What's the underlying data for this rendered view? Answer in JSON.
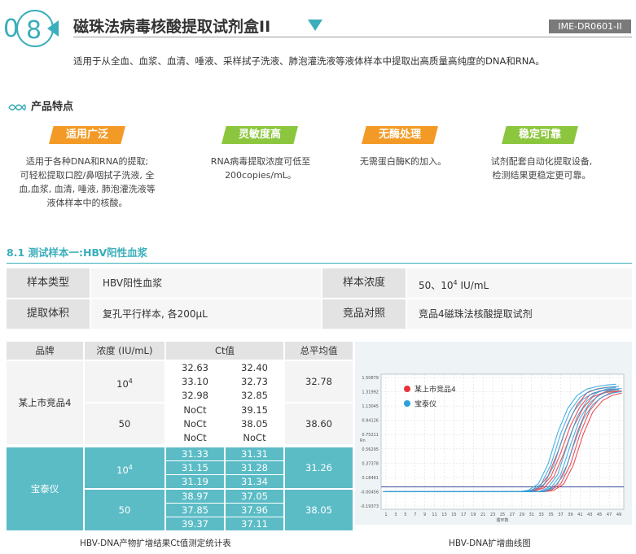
{
  "header": {
    "num_zero": "0",
    "num_eight": "8",
    "title": "磁珠法病毒核酸提取试剂盒II",
    "code": "IME-DR0601-II",
    "description": "适用于从全血、血浆、血清、唾液、采样拭子洗液、肺泡灌洗液等液体样本中提取出高质量高纯度的DNA和RNA。"
  },
  "features": {
    "title": "产品特点",
    "items": [
      {
        "label": "适用广泛",
        "lines": [
          "适用于各种DNA和RNA的提取;",
          "可轻松提取口腔/鼻咽拭子洗液, 全",
          "血,血浆, 血清, 唾液, 肺泡灌洗液等",
          "液体样本中的核酸。"
        ]
      },
      {
        "label": "灵敏度高",
        "lines": [
          "RNA病毒提取浓度可低至",
          "200copies/mL。"
        ]
      },
      {
        "label": "无酶处理",
        "lines": [
          "无需蛋白酶K的加入。"
        ]
      },
      {
        "label": "稳定可靠",
        "lines": [
          "试剂配套自动化提取设备,",
          "检测结果更稳定更可靠。"
        ]
      }
    ]
  },
  "section": {
    "title": "8.1 测试样本一:HBV阳性血浆"
  },
  "info": {
    "sample_type_label": "样本类型",
    "sample_type": "HBV阳性血浆",
    "conc_label": "样本浓度",
    "conc_pre": "50、10",
    "conc_sup": "4",
    "conc_post": " IU/mL",
    "method_label": "提取体积",
    "method": "复孔平行样本, 各200μL",
    "compare_label": "竞品对照",
    "compare": "竞品4磁珠法核酸提取试剂"
  },
  "ct_table": {
    "headers": [
      "品牌",
      "浓度 (IU/mL)",
      "Ct值",
      "总平均值"
    ],
    "groups": [
      {
        "brand": "某上市竞品4",
        "rows": [
          {
            "conc": "10",
            "conc_sup": "4",
            "ct": [
              [
                "32.63",
                "32.40"
              ],
              [
                "33.10",
                "32.73"
              ],
              [
                "32.98",
                "32.85"
              ]
            ],
            "avg": "32.78"
          },
          {
            "conc": "50",
            "conc_sup": "",
            "ct": [
              [
                "NoCt",
                "39.15"
              ],
              [
                "NoCt",
                "38.05"
              ],
              [
                "NoCt",
                "NoCt"
              ]
            ],
            "avg": "38.60"
          }
        ]
      },
      {
        "brand": "宝泰仪",
        "rows": [
          {
            "conc": "10",
            "conc_sup": "4",
            "ct": [
              [
                "31.33",
                "31.31"
              ],
              [
                "31.15",
                "31.28"
              ],
              [
                "31.19",
                "31.34"
              ]
            ],
            "avg": "31.26"
          },
          {
            "conc": "50",
            "conc_sup": "",
            "ct": [
              [
                "38.97",
                "37.05"
              ],
              [
                "37.85",
                "37.96"
              ],
              [
                "39.37",
                "37.11"
              ]
            ],
            "avg": "38.05"
          }
        ]
      }
    ],
    "caption": "HBV-DNA产物扩增结果Ct值测定统计表"
  },
  "chart_data": {
    "type": "line",
    "title": "",
    "xlabel": "循环数",
    "ylabel": "Rn",
    "y_ticks": [
      "1.50879",
      "1.31992",
      "1.13045",
      "0.94126",
      "0.75211",
      "0.56295",
      "0.37378",
      "0.18461",
      "-0.00456",
      "-0.19373"
    ],
    "x_ticks": [
      "1",
      "3",
      "5",
      "7",
      "9",
      "11",
      "13",
      "15",
      "17",
      "19",
      "21",
      "23",
      "25",
      "27",
      "29",
      "31",
      "33",
      "35",
      "37",
      "39",
      "41",
      "43",
      "45",
      "47",
      "49"
    ],
    "x": [
      1,
      3,
      5,
      7,
      9,
      11,
      13,
      15,
      17,
      19,
      21,
      23,
      25,
      27,
      29,
      31,
      33,
      35,
      37,
      39,
      41,
      43,
      45,
      47,
      49
    ],
    "series": [
      {
        "name": "某上市竞品4",
        "color": "#e8323c",
        "values_a": [
          0,
          0,
          0,
          0,
          0,
          0,
          0,
          0,
          0,
          0,
          0,
          0,
          0,
          0,
          0,
          0.01,
          0.05,
          0.2,
          0.5,
          0.85,
          1.1,
          1.25,
          1.3,
          1.32,
          1.33
        ],
        "values_b": [
          0,
          0,
          0,
          0,
          0,
          0,
          0,
          0,
          0,
          0,
          0,
          0,
          0,
          0,
          0,
          0,
          0,
          0.02,
          0.1,
          0.35,
          0.75,
          1.05,
          1.2,
          1.27,
          1.3
        ]
      },
      {
        "name": "宝泰仪",
        "color": "#2aa2dd",
        "values_a": [
          0,
          0,
          0,
          0,
          0,
          0,
          0,
          0,
          0,
          0,
          0,
          0,
          0,
          0,
          0,
          0.02,
          0.1,
          0.35,
          0.75,
          1.05,
          1.22,
          1.3,
          1.33,
          1.35,
          1.36
        ],
        "values_b": [
          0,
          0,
          0,
          0,
          0,
          0,
          0,
          0,
          0,
          0,
          0,
          0,
          0,
          0,
          0,
          0,
          0,
          0.05,
          0.22,
          0.6,
          0.95,
          1.15,
          1.25,
          1.3,
          1.32
        ]
      }
    ],
    "legend": "top-left",
    "caption": "HBV-DNA扩增曲线图"
  }
}
